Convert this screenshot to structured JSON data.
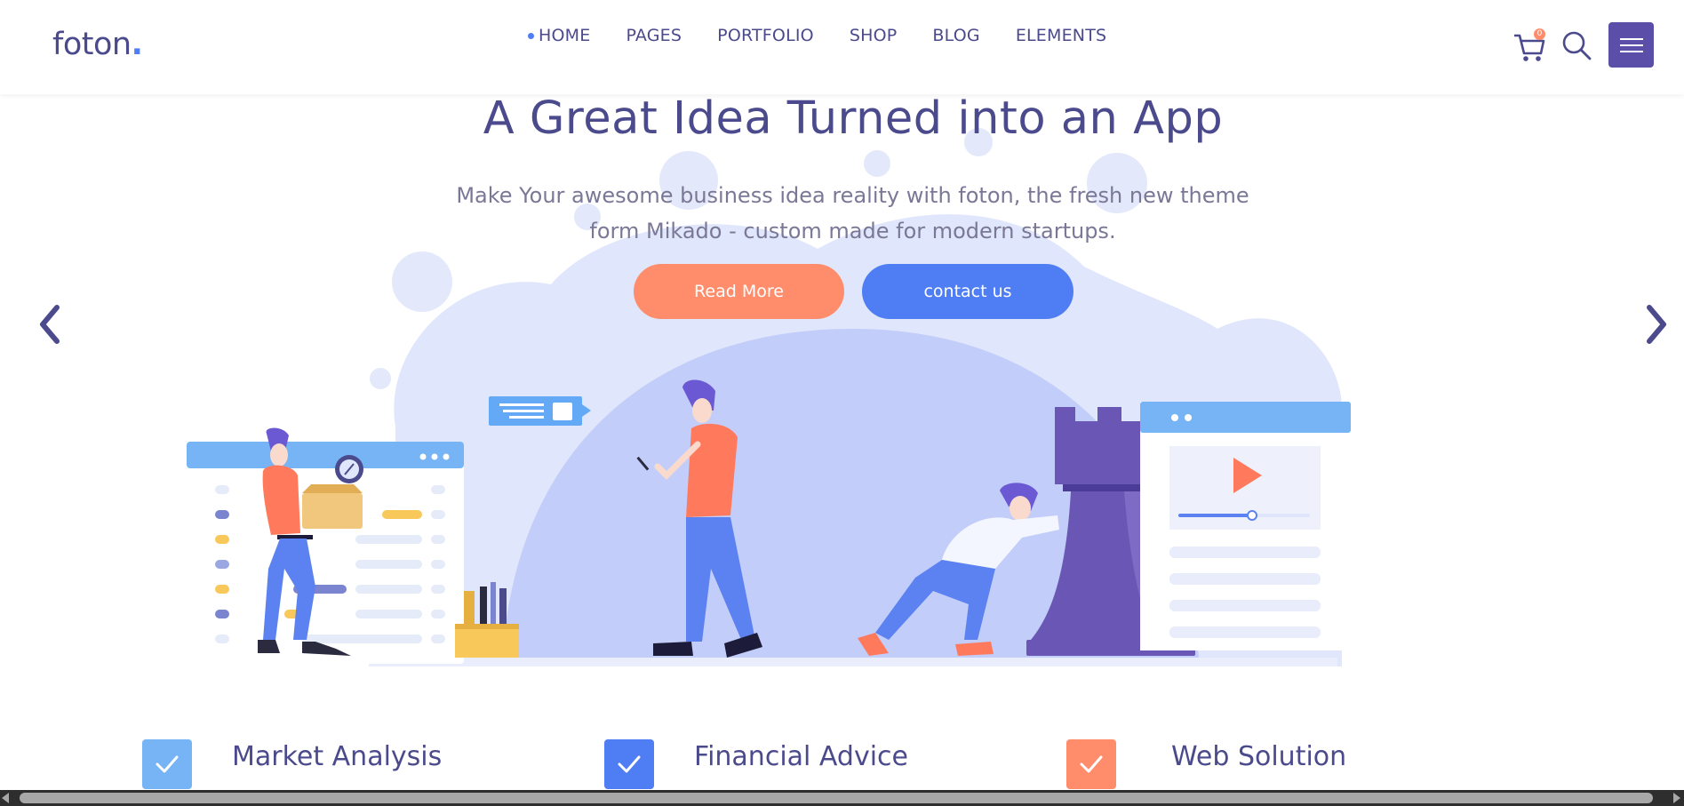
{
  "header": {
    "logo_text": "foton",
    "logo_dot": ".",
    "nav": [
      {
        "label": "HOME",
        "active": true
      },
      {
        "label": "PAGES",
        "active": false
      },
      {
        "label": "PORTFOLIO",
        "active": false
      },
      {
        "label": "SHOP",
        "active": false
      },
      {
        "label": "BLOG",
        "active": false
      },
      {
        "label": "ELEMENTS",
        "active": false
      }
    ],
    "cart_count": "0",
    "icons": {
      "cart": "cart-icon",
      "search": "search-icon",
      "menu": "hamburger-menu-icon"
    }
  },
  "hero": {
    "title": "A Great Idea Turned into an App",
    "subtitle": "Make Your awesome business idea reality with foton, the fresh new theme form Mikado - custom made for modern startups.",
    "read_more_label": "Read More",
    "contact_label": "contact us"
  },
  "features": [
    {
      "title": "Market Analysis",
      "color": "#76b4f5"
    },
    {
      "title": "Financial Advice",
      "color": "#4f7df3"
    },
    {
      "title": "Web Solution",
      "color": "#ff8d6b"
    }
  ],
  "colors": {
    "brand": "#4b4a8c",
    "accent_blue": "#4f7df3",
    "accent_orange": "#ff8d6b",
    "blob": "#e0e6fb",
    "blob_dark": "#c2cdf9"
  }
}
